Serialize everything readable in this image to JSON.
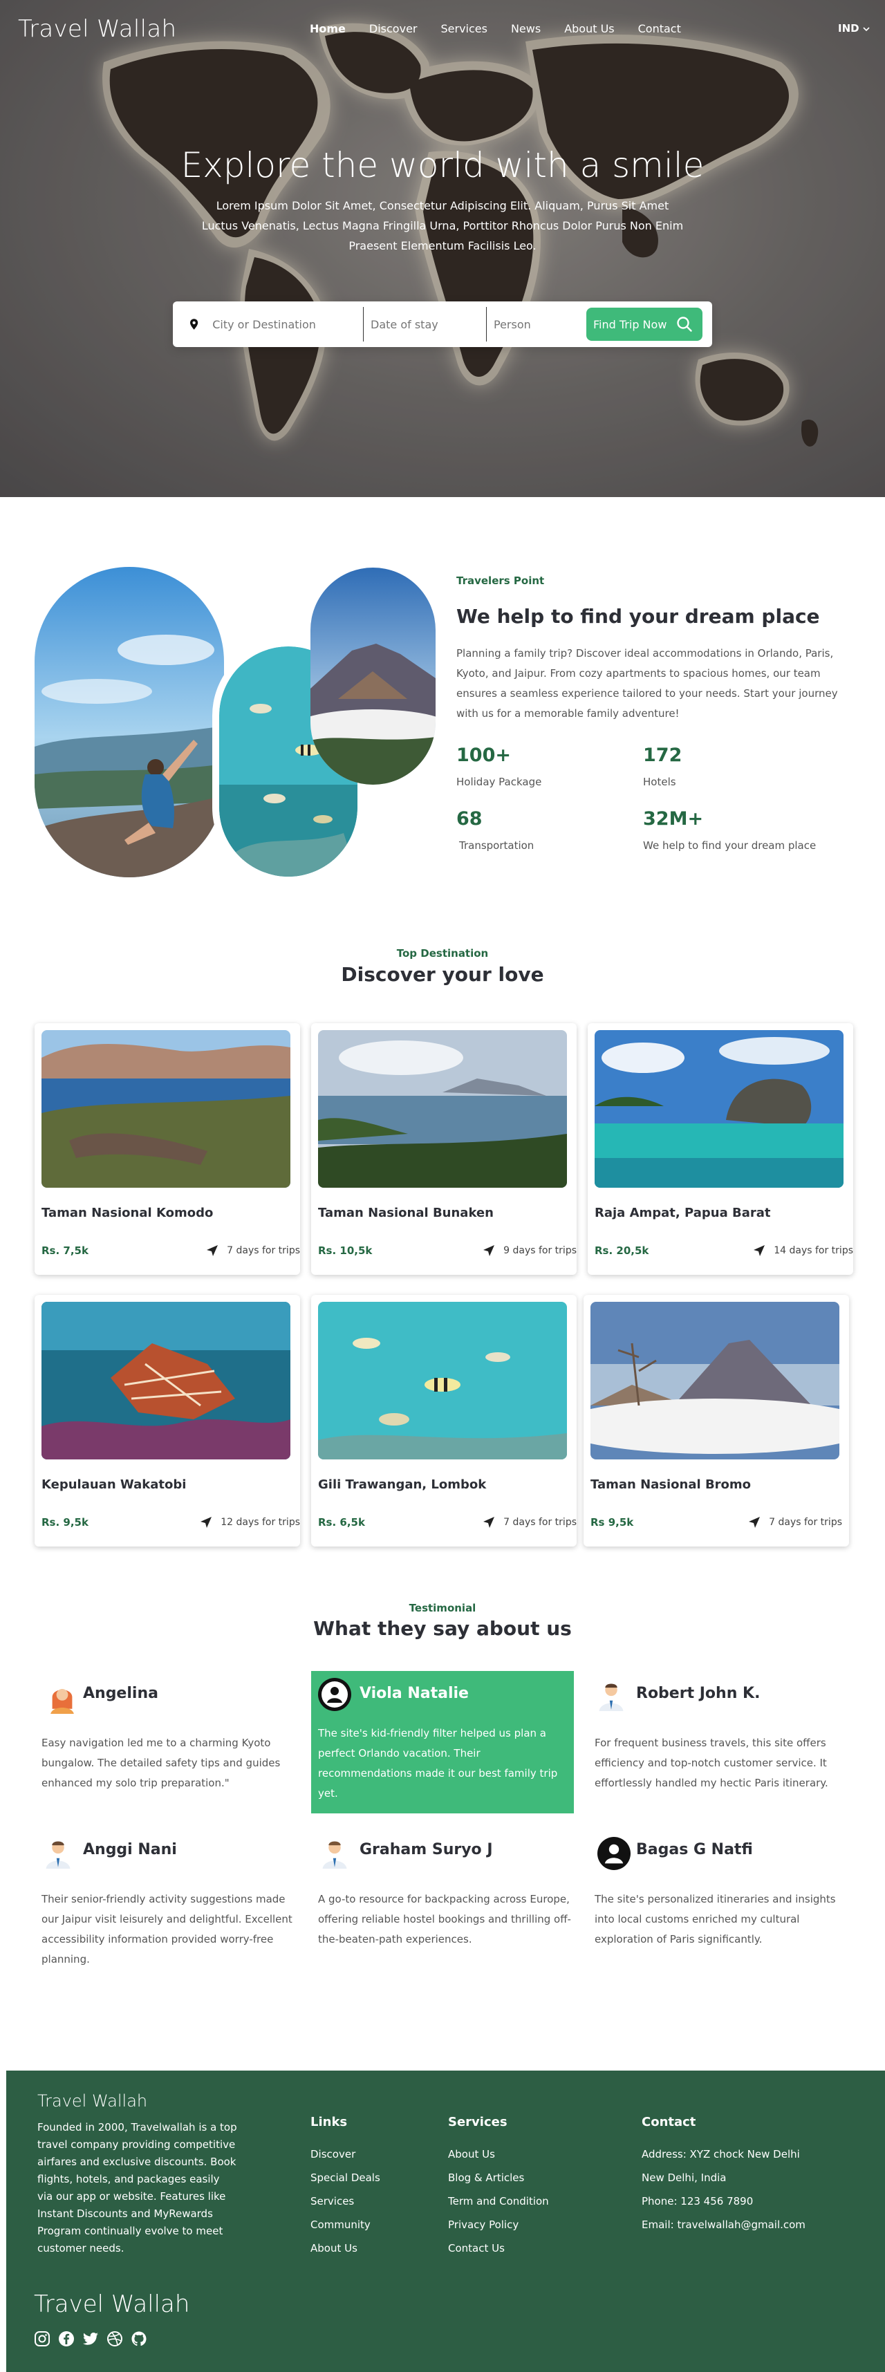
{
  "nav": {
    "brand": "Travel Wallah",
    "links": [
      "Home",
      "Discover",
      "Services",
      "News",
      "About Us",
      "Contact"
    ],
    "lang": "IND"
  },
  "hero": {
    "title": "Explore the world with a smile",
    "subtitle": "Lorem Ipsum Dolor Sit Amet, Consectetur Adipiscing Elit. Aliquam, Purus Sit Amet Luctus Venenatis, Lectus Magna Fringilla Urna, Porttitor Rhoncus Dolor Purus Non Enim Praesent Elementum Facilisis Leo.",
    "search": {
      "destination_placeholder": "City or Destination",
      "date_placeholder": "Date of stay",
      "person_placeholder": "Person",
      "button": "Find Trip Now"
    }
  },
  "about": {
    "eyebrow": "Travelers Point",
    "title": "We help to find your dream place",
    "description": "Planning a family trip? Discover ideal accommodations in Orlando, Paris, Kyoto, and Jaipur. From cozy apartments to spacious homes, our team ensures a seamless experience tailored to your needs. Start your journey with us for a memorable family adventure!",
    "stats": [
      {
        "value": "100+",
        "label": "Holiday Package"
      },
      {
        "value": "172",
        "label": "Hotels"
      },
      {
        "value": "68",
        "label": "Transportation"
      },
      {
        "value": "32M+",
        "label": "We help to find your dream place"
      }
    ]
  },
  "destinations": {
    "eyebrow": "Top Destination",
    "title": "Discover your love",
    "items": [
      {
        "name": "Taman Nasional Komodo",
        "price": "Rs. 7,5k",
        "days": "7 days for trips"
      },
      {
        "name": "Taman Nasional Bunaken",
        "price": "Rs. 10,5k",
        "days": "9 days for trips"
      },
      {
        "name": "Raja Ampat, Papua Barat",
        "price": "Rs. 20,5k",
        "days": "14 days for trips"
      },
      {
        "name": "Kepulauan Wakatobi",
        "price": "Rs. 9,5k",
        "days": "12 days for trips"
      },
      {
        "name": "Gili Trawangan, Lombok",
        "price": "Rs. 6,5k",
        "days": "7 days for trips"
      },
      {
        "name": "Taman Nasional Bromo",
        "price": "Rs 9,5k",
        "days": "7 days for trips"
      }
    ]
  },
  "testimonials": {
    "eyebrow": "Testimonial",
    "title": "What they say about us",
    "items": [
      {
        "name": "Angelina",
        "quote": "Easy navigation led me to a charming Kyoto bungalow. The detailed safety tips and guides enhanced my solo trip preparation.\""
      },
      {
        "name": "Viola Natalie",
        "quote": "The site's kid-friendly filter helped us plan a perfect Orlando vacation. Their recommendations made it our best family trip yet."
      },
      {
        "name": "Robert John K.",
        "quote": "For frequent business travels, this site offers efficiency and top-notch customer service. It effortlessly handled my hectic Paris itinerary."
      },
      {
        "name": "Anggi Nani",
        "quote": "Their senior-friendly activity suggestions made our Jaipur visit leisurely and delightful. Excellent accessibility information provided worry-free planning."
      },
      {
        "name": "Graham Suryo J",
        "quote": "A go-to resource for backpacking across Europe, offering reliable hostel bookings and thrilling off-the-beaten-path experiences."
      },
      {
        "name": "Bagas G Natfi",
        "quote": "The site's personalized itineraries and insights into local customs enriched my cultural exploration of Paris significantly."
      }
    ]
  },
  "footer": {
    "brand": "Travel Wallah",
    "about": "Founded in 2000, Travelwallah is a top travel company providing competitive airfares and exclusive discounts. Book flights, hotels, and packages easily via our app or website. Features like Instant Discounts and MyRewards Program continually evolve to meet customer needs.",
    "links_title": "Links",
    "links": [
      "Discover",
      "Special Deals",
      "Services",
      "Community",
      "About Us"
    ],
    "services_title": "Services",
    "services": [
      "About Us",
      "Blog & Articles",
      "Term and Condition",
      "Privacy Policy",
      "Contact Us"
    ],
    "contact_title": "Contact",
    "contact": [
      "Address: XYZ chock New Delhi",
      "New Delhi, India",
      "Phone: 123 456 7890",
      "Email: travelwallah@gmail.com"
    ],
    "brand_bottom": "Travel Wallah",
    "socials": [
      "instagram-icon",
      "facebook-icon",
      "twitter-icon",
      "dribbble-icon",
      "github-icon"
    ]
  },
  "colors": {
    "accent": "#3fba7a",
    "dark_green": "#256843",
    "footer_bg": "#2d5e44"
  }
}
